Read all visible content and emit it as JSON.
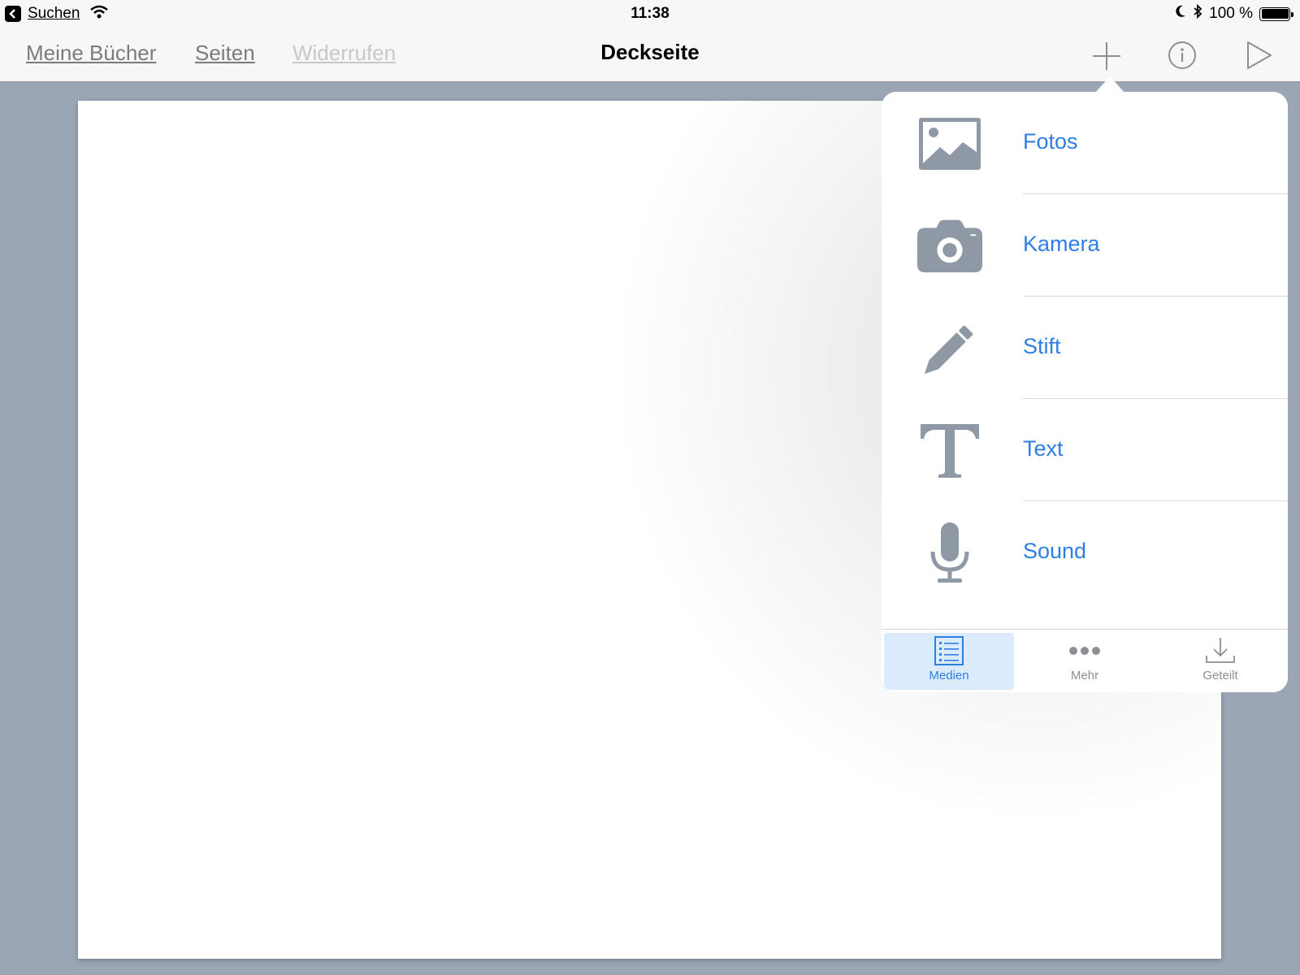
{
  "status_bar": {
    "back_label": "Suchen",
    "time": "11:38",
    "battery": "100 %",
    "battery_level": 1.0
  },
  "nav": {
    "my_books": "Meine Bücher",
    "pages": "Seiten",
    "undo": "Widerrufen",
    "title": "Deckseite"
  },
  "popover": {
    "items": [
      {
        "label": "Fotos",
        "icon": "photo-icon"
      },
      {
        "label": "Kamera",
        "icon": "camera-icon"
      },
      {
        "label": "Stift",
        "icon": "pencil-icon"
      },
      {
        "label": "Text",
        "icon": "text-icon"
      },
      {
        "label": "Sound",
        "icon": "microphone-icon"
      }
    ],
    "tabs": [
      {
        "label": "Medien",
        "icon": "list-icon",
        "active": true
      },
      {
        "label": "Mehr",
        "icon": "ellipsis-icon",
        "active": false
      },
      {
        "label": "Geteilt",
        "icon": "download-icon",
        "active": false
      }
    ]
  },
  "colors": {
    "accent": "#2d7fe6",
    "icon_gray": "#8f99a6",
    "background": "#9aa6b4"
  }
}
